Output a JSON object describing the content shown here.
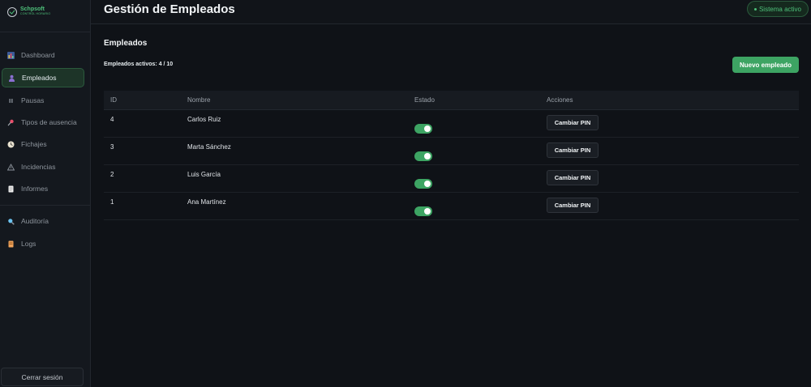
{
  "brand": {
    "name": "Schpsoft",
    "subtitle": "CONTROL HORARIO"
  },
  "sidebar": {
    "items": [
      {
        "label": "Dashboard",
        "icon": "bar-chart-icon",
        "active": false
      },
      {
        "label": "Empleados",
        "icon": "user-icon",
        "active": true
      },
      {
        "label": "Pausas",
        "icon": "pause-icon",
        "active": false
      },
      {
        "label": "Tipos de ausencia",
        "icon": "pin-icon",
        "active": false
      },
      {
        "label": "Fichajes",
        "icon": "clock-icon",
        "active": false
      },
      {
        "label": "Incidencias",
        "icon": "warning-icon",
        "active": false
      },
      {
        "label": "Informes",
        "icon": "document-icon",
        "active": false
      },
      {
        "label": "Auditoría",
        "icon": "magnifier-icon",
        "active": false
      },
      {
        "label": "Logs",
        "icon": "scroll-icon",
        "active": false
      }
    ],
    "logout_label": "Cerrar sesión"
  },
  "header": {
    "title": "Gestión de Empleados",
    "status": "Sistema activo"
  },
  "main": {
    "section_title": "Empleados",
    "count_text": "Empleados activos: 4 / 10",
    "new_button": "Nuevo empleado",
    "columns": [
      "ID",
      "Nombre",
      "Estado",
      "Acciones"
    ],
    "rows": [
      {
        "id": "4",
        "name": "Carlos Ruiz",
        "active": true,
        "action": "Cambiar PIN"
      },
      {
        "id": "3",
        "name": "Marta Sánchez",
        "active": true,
        "action": "Cambiar PIN"
      },
      {
        "id": "2",
        "name": "Luis García",
        "active": true,
        "action": "Cambiar PIN"
      },
      {
        "id": "1",
        "name": "Ana Martínez",
        "active": true,
        "action": "Cambiar PIN"
      }
    ]
  },
  "colors": {
    "accent": "#3da463",
    "background": "#0f1217",
    "sidebar": "#14181e"
  }
}
